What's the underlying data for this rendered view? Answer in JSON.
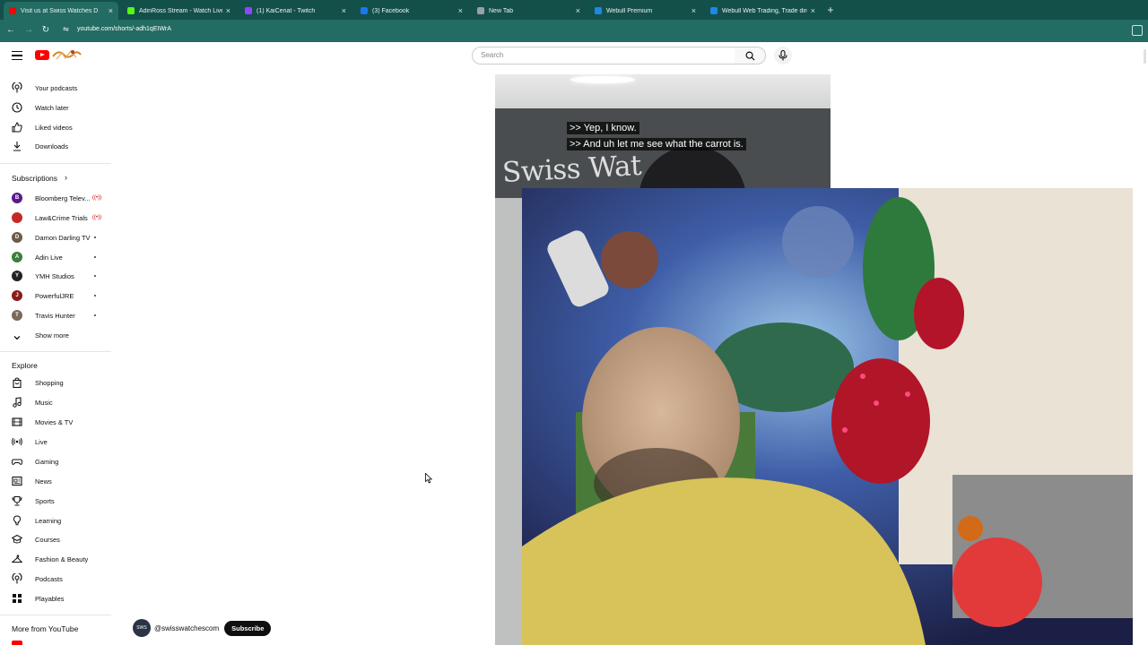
{
  "browser": {
    "tabs": [
      {
        "label": "Visit us at Swiss Watches D",
        "active": true,
        "favicon_color": "#ff0000"
      },
      {
        "label": "AdinRoss Stream - Watch Live",
        "active": false,
        "favicon_color": "#53fc18"
      },
      {
        "label": "(1) KaiCenat - Twitch",
        "active": false,
        "favicon_color": "#9146ff"
      },
      {
        "label": "(3) Facebook",
        "active": false,
        "favicon_color": "#1877f2"
      },
      {
        "label": "New Tab",
        "active": false,
        "favicon_color": "#9aa0a6"
      },
      {
        "label": "Webull Premium",
        "active": false,
        "favicon_color": "#1e88e5"
      },
      {
        "label": "Webull Web Trading, Trade dire",
        "active": false,
        "favicon_color": "#1e88e5"
      }
    ],
    "new_tab_label": "+",
    "url": "youtube.com/shorts/-adh1qEIWrA"
  },
  "header": {
    "search_placeholder": "Search"
  },
  "sidebar": {
    "you_items": [
      {
        "label": "Your podcasts",
        "icon": "podcast-icon"
      },
      {
        "label": "Watch later",
        "icon": "clock-icon"
      },
      {
        "label": "Liked videos",
        "icon": "thumbs-up-icon"
      },
      {
        "label": "Downloads",
        "icon": "download-icon"
      }
    ],
    "subscriptions_heading": "Subscriptions",
    "subscriptions": [
      {
        "label": "Bloomberg Telev...",
        "status": "live",
        "avatar_color": "#5a1a8c",
        "initial": "B"
      },
      {
        "label": "Law&Crime Trials",
        "status": "live",
        "avatar_color": "#c62828",
        "initial": "LC"
      },
      {
        "label": "Damon Darling TV",
        "status": "new",
        "avatar_color": "#6d5a48",
        "initial": "D"
      },
      {
        "label": "Adin Live",
        "status": "new",
        "avatar_color": "#3b7d3a",
        "initial": "A"
      },
      {
        "label": "YMH Studios",
        "status": "new",
        "avatar_color": "#222222",
        "initial": "Y"
      },
      {
        "label": "PowerfulJRE",
        "status": "new",
        "avatar_color": "#8b1c1c",
        "initial": "J"
      },
      {
        "label": "Travis Hunter",
        "status": "new",
        "avatar_color": "#7a6a5a",
        "initial": "T"
      }
    ],
    "show_more": "Show more",
    "explore_heading": "Explore",
    "explore_items": [
      {
        "label": "Shopping",
        "icon": "shopping-bag-icon"
      },
      {
        "label": "Music",
        "icon": "music-note-icon"
      },
      {
        "label": "Movies & TV",
        "icon": "film-icon"
      },
      {
        "label": "Live",
        "icon": "live-icon"
      },
      {
        "label": "Gaming",
        "icon": "gamepad-icon"
      },
      {
        "label": "News",
        "icon": "newspaper-icon"
      },
      {
        "label": "Sports",
        "icon": "trophy-icon"
      },
      {
        "label": "Learning",
        "icon": "lightbulb-icon"
      },
      {
        "label": "Courses",
        "icon": "graduation-cap-icon"
      },
      {
        "label": "Fashion & Beauty",
        "icon": "hanger-icon"
      },
      {
        "label": "Podcasts",
        "icon": "podcast-icon"
      },
      {
        "label": "Playables",
        "icon": "playables-icon"
      }
    ],
    "more_heading": "More from YouTube"
  },
  "video": {
    "sign_text": "Swiss Wat",
    "captions": [
      ">> Yep, I know.",
      ">> And uh let me see what the carrot is."
    ],
    "channel_handle": "@swisswatchescom",
    "subscribe_label": "Subscribe"
  },
  "colors": {
    "tabbar": "#14504a",
    "navbar": "#236c63",
    "youtube_red": "#ff0000",
    "live_red": "#cc0000"
  }
}
